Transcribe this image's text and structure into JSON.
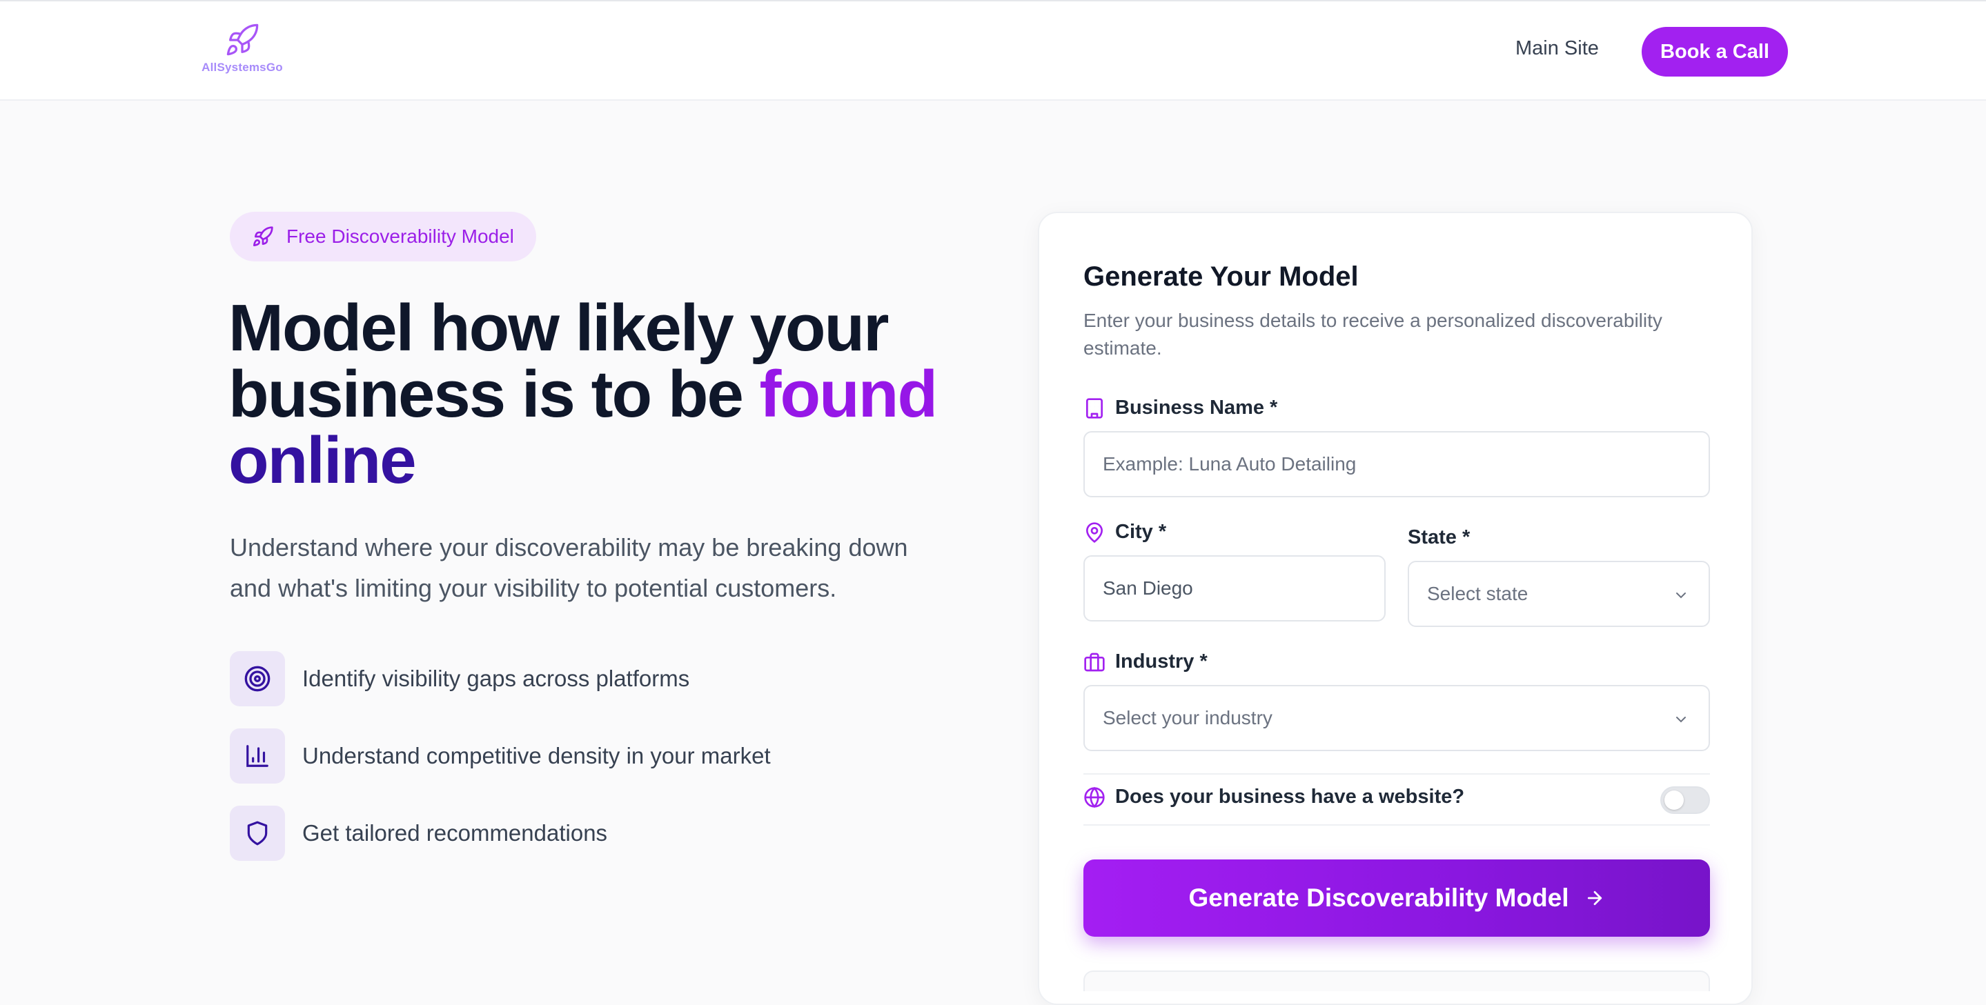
{
  "header": {
    "logo_text": "AllSystemsGo",
    "nav_main_site": "Main Site",
    "book_call": "Book a Call"
  },
  "hero": {
    "badge": "Free Discoverability Model",
    "headline_part1": "Model how likely your business is to be ",
    "headline_found": "found",
    "headline_online": "online",
    "subtext": "Understand where your discoverability may be breaking down and what's limiting your visibility to potential customers.",
    "features": [
      {
        "icon": "target-icon",
        "text": "Identify visibility gaps across platforms"
      },
      {
        "icon": "bar-chart-icon",
        "text": "Understand competitive density in your market"
      },
      {
        "icon": "shield-icon",
        "text": "Get tailored recommendations"
      }
    ]
  },
  "form": {
    "title": "Generate Your Model",
    "description": "Enter your business details to receive a personalized discoverability estimate.",
    "business_name_label": "Business Name *",
    "business_name_placeholder": "Example: Luna Auto Detailing",
    "city_label": "City *",
    "city_value": "San Diego",
    "state_label": "State *",
    "state_placeholder": "Select state",
    "industry_label": "Industry *",
    "industry_placeholder": "Select your industry",
    "website_question": "Does your business have a website?",
    "website_toggle_on": false,
    "submit_label": "Generate Discoverability Model"
  },
  "colors": {
    "accent": "#a221f0",
    "accent_dark": "#3412a0",
    "badge_bg": "#f3e6fc",
    "feature_icon_bg": "#ece6f8"
  }
}
